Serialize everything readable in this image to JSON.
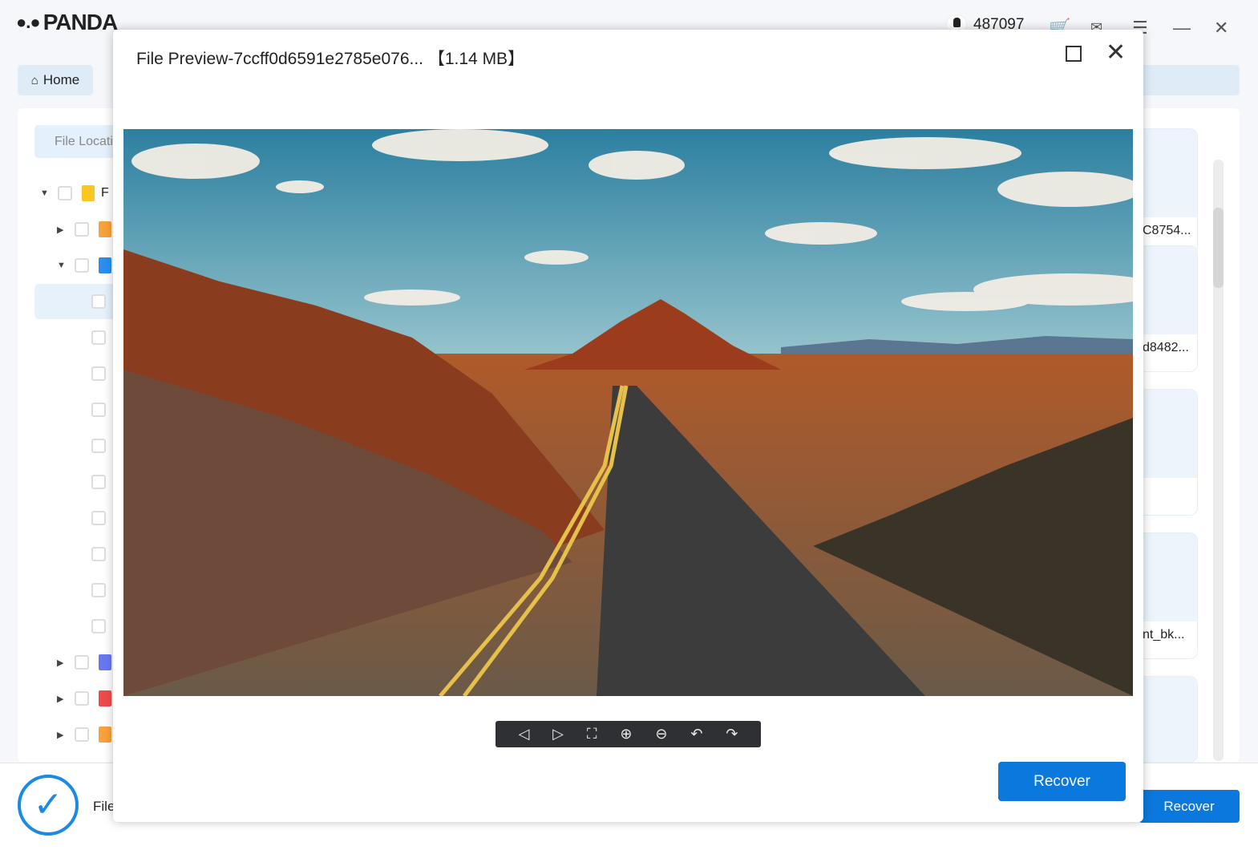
{
  "app": {
    "logo_text": "PANDA",
    "user_id": "487097",
    "home_label": "Home",
    "file_location_label": "File Locati",
    "folder_label": "F",
    "bottom_file_label": "File",
    "recover_label": "Recover",
    "header_icons": [
      "cart-icon",
      "mail-icon",
      "menu-icon",
      "minimize-icon",
      "close-icon"
    ],
    "cards": [
      {
        "label": "C8754..."
      },
      {
        "label": "d8482..."
      },
      {
        "label": ""
      },
      {
        "label": "nt_bk..."
      },
      {
        "label": ""
      }
    ],
    "tree": [
      {
        "level": 0,
        "expander": "expanded",
        "icon": "folder-icon",
        "color": "#f9c623"
      },
      {
        "level": 1,
        "expander": "collapsed",
        "icon": "document-icon",
        "color": "#f7a23b"
      },
      {
        "level": 1,
        "expander": "expanded",
        "icon": "cloud-icon",
        "color": "#2b8ef0"
      },
      {
        "level": 2,
        "icon": "jpg-file-icon",
        "color": "#4d8fe0",
        "selected": true
      },
      {
        "level": 2,
        "icon": "png-file-icon",
        "color": "#8fbf7a"
      },
      {
        "level": 2,
        "icon": "gif-file-icon",
        "color": "#4aa3f0"
      },
      {
        "level": 2,
        "icon": "svg-file-icon",
        "color": "#8d82d6"
      },
      {
        "level": 2,
        "icon": "blank-file-icon",
        "color": "#cccccc"
      },
      {
        "level": 2,
        "icon": "tiff-file-icon",
        "color": "#f2b66a"
      },
      {
        "level": 2,
        "icon": "blank-file-icon",
        "color": "#cccccc"
      },
      {
        "level": 2,
        "icon": "bmp-file-icon",
        "color": "#6b7fb8"
      },
      {
        "level": 2,
        "icon": "image-file-icon",
        "color": "#2d6fc0"
      },
      {
        "level": 2,
        "icon": "edge-icon",
        "color": "#1e88c8"
      },
      {
        "level": 1,
        "expander": "collapsed",
        "icon": "video-icon",
        "color": "#6a78f0"
      },
      {
        "level": 1,
        "expander": "collapsed",
        "icon": "music-icon",
        "color": "#f04a4a"
      },
      {
        "level": 1,
        "expander": "collapsed",
        "icon": "archive-icon",
        "color": "#f7a23b"
      }
    ]
  },
  "modal": {
    "title": "File Preview-7ccff0d6591e2785e076...",
    "size": "【1.14 MB】",
    "recover_label": "Recover",
    "toolbar": [
      "previous-icon",
      "next-icon",
      "fullscreen-icon",
      "zoom-in-icon",
      "zoom-out-icon",
      "rotate-left-icon",
      "rotate-right-icon"
    ]
  },
  "colors": {
    "accent": "#0a78dc",
    "cart": "#f07a1e"
  }
}
